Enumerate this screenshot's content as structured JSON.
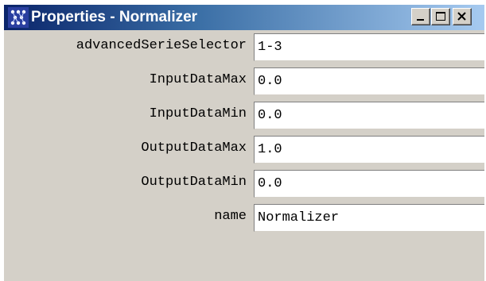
{
  "window": {
    "title": "Properties - Normalizer",
    "title_icon": "java-app-icon",
    "buttons": {
      "minimize": "minimize-icon",
      "maximize": "maximize-icon",
      "close": "close-icon"
    }
  },
  "properties": [
    {
      "label": "advancedSerieSelector",
      "value": "1-3"
    },
    {
      "label": "InputDataMax",
      "value": "0.0"
    },
    {
      "label": "InputDataMin",
      "value": "0.0"
    },
    {
      "label": "OutputDataMax",
      "value": "1.0"
    },
    {
      "label": "OutputDataMin",
      "value": "0.0"
    },
    {
      "label": "name",
      "value": "Normalizer"
    }
  ],
  "colors": {
    "title_active": "#0a246a",
    "title_gradient_end": "#a6caf0",
    "face": "#d4d0c8",
    "field_bg": "#ffffff"
  }
}
